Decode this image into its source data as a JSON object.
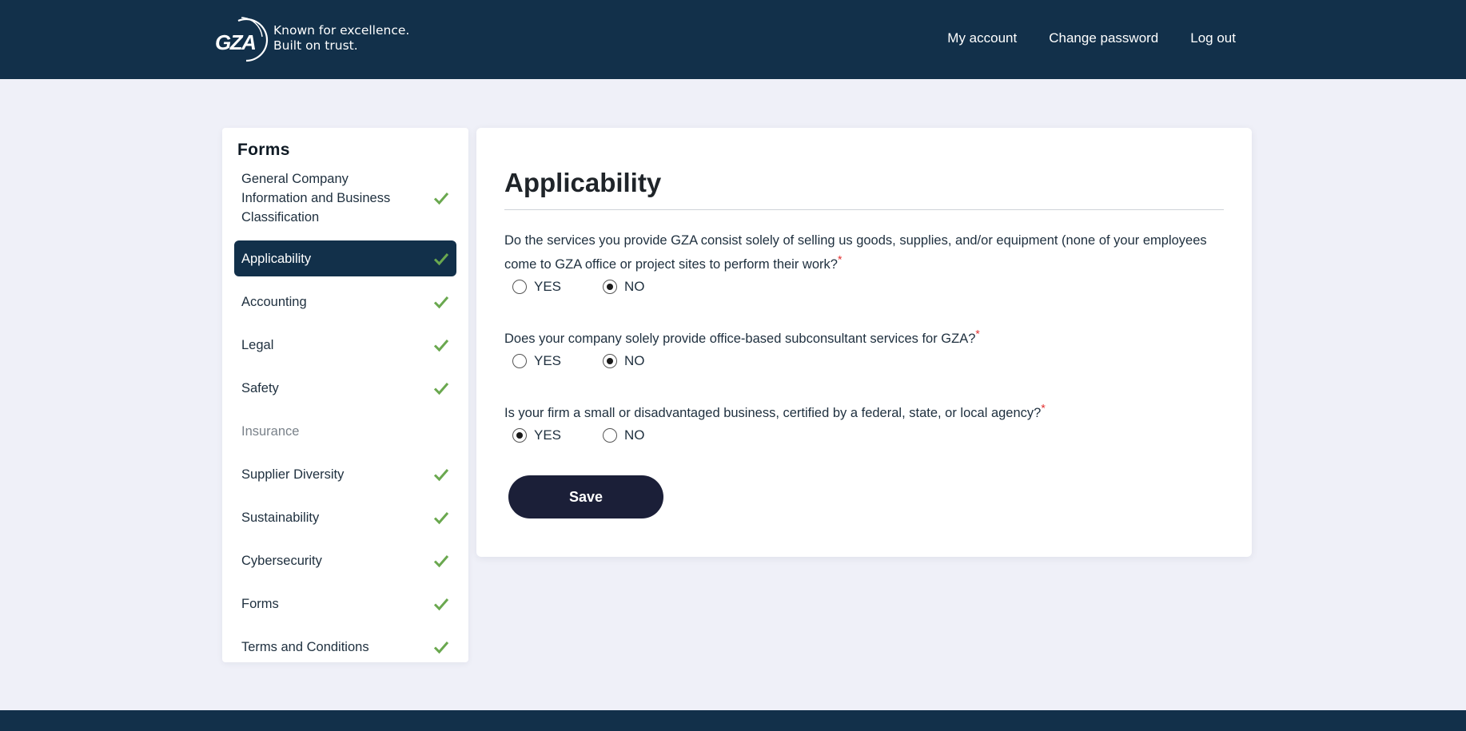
{
  "header": {
    "logo_text": "GZA",
    "tagline_line1": "Known for excellence.",
    "tagline_line2": "Built on trust.",
    "nav": [
      {
        "label": "My account"
      },
      {
        "label": "Change password"
      },
      {
        "label": "Log out"
      }
    ]
  },
  "sidebar": {
    "title": "Forms",
    "items": [
      {
        "label": "General Company Information and Business Classification",
        "state": "complete"
      },
      {
        "label": "Applicability",
        "state": "complete",
        "active": true
      },
      {
        "label": "Accounting",
        "state": "complete"
      },
      {
        "label": "Legal",
        "state": "complete"
      },
      {
        "label": "Safety",
        "state": "complete"
      },
      {
        "label": "Insurance",
        "state": "incomplete"
      },
      {
        "label": "Supplier Diversity",
        "state": "complete"
      },
      {
        "label": "Sustainability",
        "state": "complete"
      },
      {
        "label": "Cybersecurity",
        "state": "complete"
      },
      {
        "label": "Forms",
        "state": "complete"
      },
      {
        "label": "Terms and Conditions",
        "state": "complete"
      }
    ]
  },
  "main": {
    "title": "Applicability",
    "required_marker": "*",
    "questions": [
      {
        "text": "Do the services you provide GZA consist solely of selling us goods, supplies, and/or equipment (none of your employees come to GZA office or project sites to perform their work?",
        "options": [
          {
            "label": "YES",
            "selected": false
          },
          {
            "label": "NO",
            "selected": true
          }
        ]
      },
      {
        "text": "Does your company solely provide office-based subconsultant services for GZA?",
        "options": [
          {
            "label": "YES",
            "selected": false
          },
          {
            "label": "NO",
            "selected": true
          }
        ]
      },
      {
        "text": "Is your firm a small or disadvantaged business, certified by a federal, state, or local agency?",
        "options": [
          {
            "label": "YES",
            "selected": true
          },
          {
            "label": "NO",
            "selected": false
          }
        ]
      }
    ],
    "save_label": "Save"
  },
  "colors": {
    "header_bg": "#12304a",
    "page_bg": "#eff0f8",
    "check_green": "#6aa84f",
    "save_bg": "#1b1f38",
    "required_red": "#e12b2b"
  },
  "icons": {
    "complete": "checkmark-icon"
  }
}
